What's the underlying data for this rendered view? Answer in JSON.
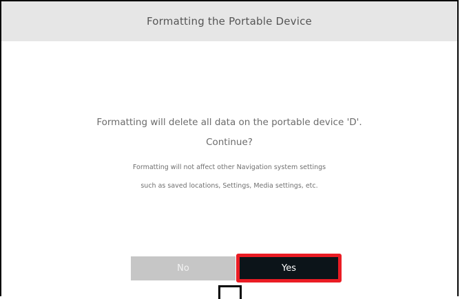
{
  "dialog": {
    "title": "Formatting the Portable Device",
    "message_line1": "Formatting will delete all data on the portable device 'D'.",
    "message_line2": "Continue?",
    "note_line1": "Formatting will not affect other Navigation system settings",
    "note_line2": "such as saved locations, Settings, Media settings, etc.",
    "buttons": {
      "no_label": "No",
      "yes_label": "Yes"
    }
  },
  "colors": {
    "title_bar": "#e6e6e6",
    "no_button": "#c6c6c6",
    "yes_button": "#0c1419",
    "highlight_border": "#ea1c24"
  }
}
